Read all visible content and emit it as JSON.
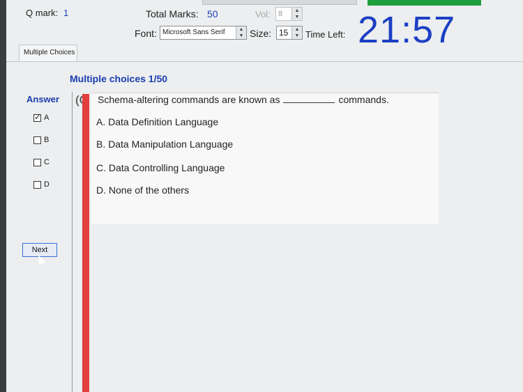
{
  "header": {
    "q_mark_label": "Q mark:",
    "q_mark_value": "1",
    "total_marks_label": "Total Marks:",
    "total_marks_value": "50",
    "vol_label": "Vol:",
    "vol_value": "8",
    "font_label": "Font:",
    "font_value": "Microsoft Sans Serif",
    "size_label": "Size:",
    "size_value": "15",
    "time_left_label": "Time Left:",
    "timer": "21:57"
  },
  "tab": {
    "label": "Multiple Choices"
  },
  "main": {
    "section_title": "Multiple choices 1/50",
    "answer_title": "Answer",
    "answer_options": [
      {
        "label": "A",
        "checked": true
      },
      {
        "label": "B",
        "checked": false
      },
      {
        "label": "C",
        "checked": false
      },
      {
        "label": "D",
        "checked": false
      }
    ],
    "next_label": "Next"
  },
  "question": {
    "number_prefix": "(C",
    "text_before_blank": "Schema-altering commands are known as",
    "text_after_blank": "commands.",
    "options": [
      "A.  Data Definition Language",
      "B.  Data Manipulation Language",
      "C.  Data Controlling Language",
      "D.  None of the others"
    ]
  },
  "colors": {
    "accent_blue": "#1a3db0",
    "timer_blue": "#1c3fc4",
    "red_bar": "#e23f3f",
    "green_bar": "#1e9e3c"
  }
}
